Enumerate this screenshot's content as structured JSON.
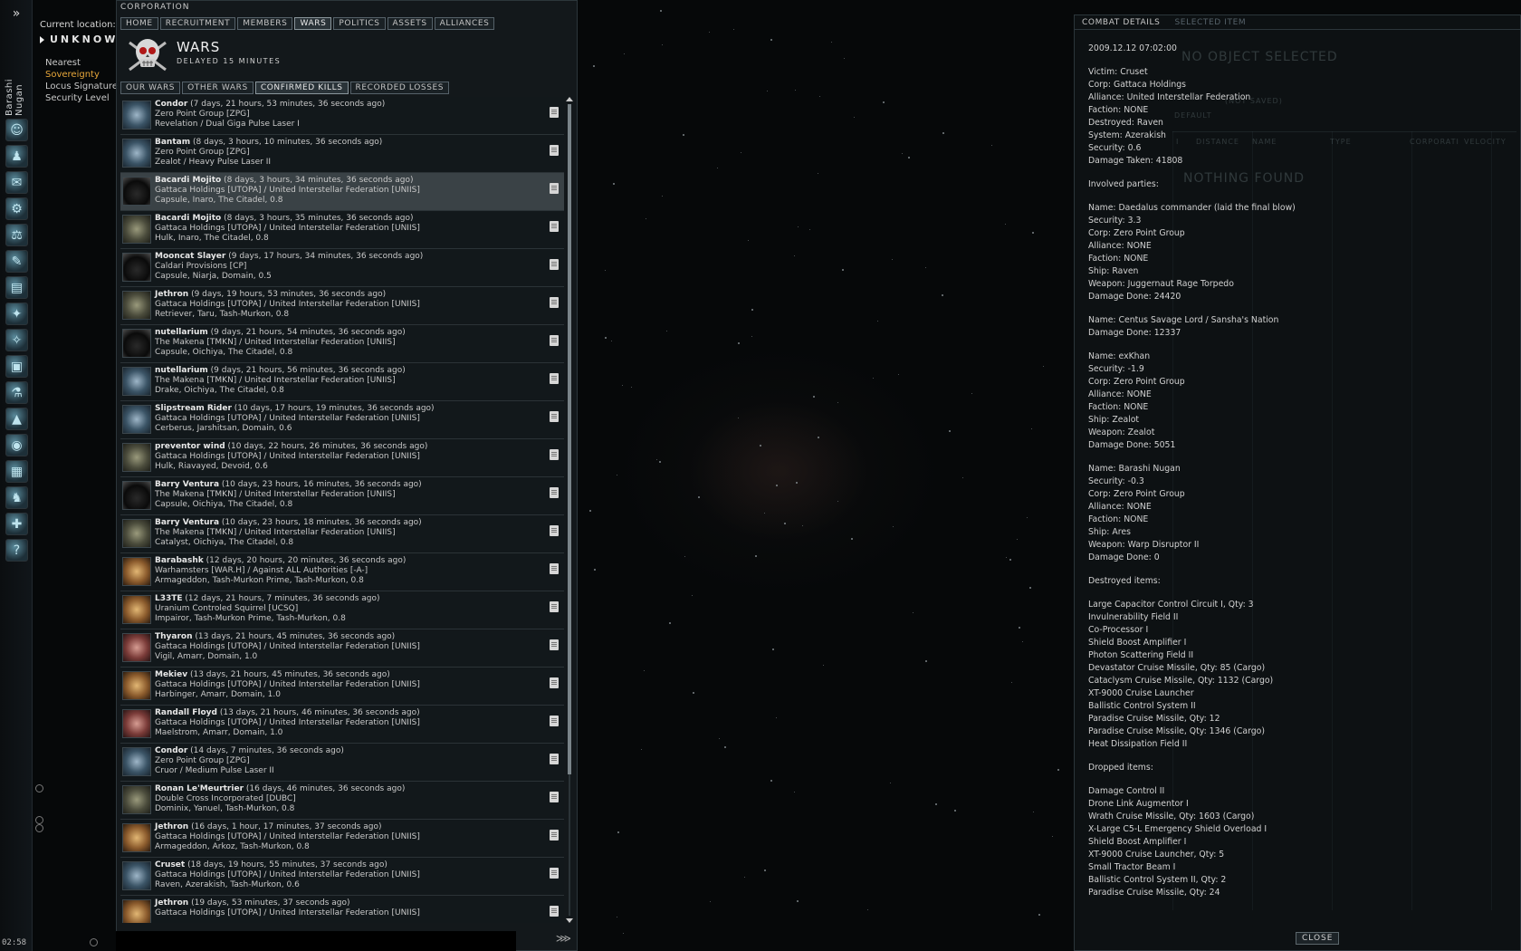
{
  "neocom": {
    "character_name": "Barashi Nugan",
    "clock": "02:58"
  },
  "location": {
    "label": "Current location:",
    "system": "UNKNOW",
    "links": [
      "Nearest",
      "Sovereignty",
      "Locus Signature",
      "Security Level"
    ]
  },
  "corp_window": {
    "title": "CORPORATION",
    "tabs": [
      "HOME",
      "RECRUITMENT",
      "MEMBERS",
      "WARS",
      "POLITICS",
      "ASSETS",
      "ALLIANCES"
    ],
    "active_tab": "WARS",
    "header_title": "WARS",
    "header_sub": "DELAYED 15 MINUTES",
    "subtabs": [
      "OUR WARS",
      "OTHER WARS",
      "CONFIRMED KILLS",
      "RECORDED LOSSES"
    ],
    "active_subtab": "CONFIRMED KILLS"
  },
  "kills": [
    {
      "name": "Condor",
      "time": "(7 days, 21 hours, 53 minutes, 36 seconds ago)",
      "l2": "Zero Point Group [ZPG]",
      "l3": "Revelation / Dual Giga Pulse Laser I",
      "t": "frig"
    },
    {
      "name": "Bantam",
      "time": "(8 days, 3 hours, 10 minutes, 36 seconds ago)",
      "l2": "Zero Point Group [ZPG]",
      "l3": "Zealot / Heavy Pulse Laser II",
      "t": "frig"
    },
    {
      "name": "Bacardi Mojito",
      "time": "(8 days, 3 hours, 34 minutes, 36 seconds ago)",
      "l2": "Gattaca Holdings [UTOPA] / United Interstellar Federation [UNIIS]",
      "l3": "Capsule, Inaro, The Citadel, 0.8",
      "t": "pod",
      "selected": true
    },
    {
      "name": "Bacardi Mojito",
      "time": "(8 days, 3 hours, 35 minutes, 36 seconds ago)",
      "l2": "Gattaca Holdings [UTOPA] / United Interstellar Federation [UNIIS]",
      "l3": "Hulk, Inaro, The Citadel, 0.8",
      "t": "ind"
    },
    {
      "name": "Mooncat Slayer",
      "time": "(9 days, 17 hours, 34 minutes, 36 seconds ago)",
      "l2": "Caldari Provisions [CP]",
      "l3": "Capsule, Niarja, Domain, 0.5",
      "t": "pod"
    },
    {
      "name": "Jethron",
      "time": "(9 days, 19 hours, 53 minutes, 36 seconds ago)",
      "l2": "Gattaca Holdings [UTOPA] / United Interstellar Federation [UNIIS]",
      "l3": "Retriever, Taru, Tash-Murkon, 0.8",
      "t": "ind"
    },
    {
      "name": "nutellarium",
      "time": "(9 days, 21 hours, 54 minutes, 36 seconds ago)",
      "l2": "The Makena [TMKN] / United Interstellar Federation [UNIIS]",
      "l3": "Capsule, Oichiya, The Citadel, 0.8",
      "t": "pod"
    },
    {
      "name": "nutellarium",
      "time": "(9 days, 21 hours, 56 minutes, 36 seconds ago)",
      "l2": "The Makena [TMKN] / United Interstellar Federation [UNIIS]",
      "l3": "Drake, Oichiya, The Citadel, 0.8",
      "t": "frig"
    },
    {
      "name": "Slipstream Rider",
      "time": "(10 days, 17 hours, 19 minutes, 36 seconds ago)",
      "l2": "Gattaca Holdings [UTOPA] / United Interstellar Federation [UNIIS]",
      "l3": "Cerberus, Jarshitsan, Domain, 0.6",
      "t": "frig"
    },
    {
      "name": "preventor wind",
      "time": "(10 days, 22 hours, 26 minutes, 36 seconds ago)",
      "l2": "Gattaca Holdings [UTOPA] / United Interstellar Federation [UNIIS]",
      "l3": "Hulk, Riavayed, Devoid, 0.6",
      "t": "ind"
    },
    {
      "name": "Barry Ventura",
      "time": "(10 days, 23 hours, 16 minutes, 36 seconds ago)",
      "l2": "The Makena [TMKN] / United Interstellar Federation [UNIIS]",
      "l3": "Capsule, Oichiya, The Citadel, 0.8",
      "t": "pod"
    },
    {
      "name": "Barry Ventura",
      "time": "(10 days, 23 hours, 18 minutes, 36 seconds ago)",
      "l2": "The Makena [TMKN] / United Interstellar Federation [UNIIS]",
      "l3": "Catalyst, Oichiya, The Citadel, 0.8",
      "t": "ind"
    },
    {
      "name": "Barabashk",
      "time": "(12 days, 20 hours, 20 minutes, 36 seconds ago)",
      "l2": "Warhamsters [WAR.H] / Against ALL Authorities [-A-]",
      "l3": "Armageddon, Tash-Murkon Prime, Tash-Murkon, 0.8",
      "t": "amarr"
    },
    {
      "name": "L33TE",
      "time": "(12 days, 21 hours, 7 minutes, 36 seconds ago)",
      "l2": "Uranium Controled Squirrel [UCSQ]",
      "l3": "Impairor, Tash-Murkon Prime, Tash-Murkon, 0.8",
      "t": "amarr"
    },
    {
      "name": "Thyaron",
      "time": "(13 days, 21 hours, 45 minutes, 36 seconds ago)",
      "l2": "Gattaca Holdings [UTOPA] / United Interstellar Federation [UNIIS]",
      "l3": "Vigil, Amarr, Domain, 1.0",
      "t": "red"
    },
    {
      "name": "Mekiev",
      "time": "(13 days, 21 hours, 45 minutes, 36 seconds ago)",
      "l2": "Gattaca Holdings [UTOPA] / United Interstellar Federation [UNIIS]",
      "l3": "Harbinger, Amarr, Domain, 1.0",
      "t": "amarr"
    },
    {
      "name": "Randall Floyd",
      "time": "(13 days, 21 hours, 46 minutes, 36 seconds ago)",
      "l2": "Gattaca Holdings [UTOPA] / United Interstellar Federation [UNIIS]",
      "l3": "Maelstrom, Amarr, Domain, 1.0",
      "t": "red"
    },
    {
      "name": "Condor",
      "time": "(14 days, 7 minutes, 36 seconds ago)",
      "l2": "Zero Point Group [ZPG]",
      "l3": "Cruor / Medium Pulse Laser II",
      "t": "frig"
    },
    {
      "name": "Ronan Le'Meurtrier",
      "time": "(16 days, 46 minutes, 36 seconds ago)",
      "l2": "Double Cross Incorporated [DUBC]",
      "l3": "Dominix, Yanuel, Tash-Murkon, 0.8",
      "t": "ind"
    },
    {
      "name": "Jethron",
      "time": "(16 days, 1 hour, 17 minutes, 37 seconds ago)",
      "l2": "Gattaca Holdings [UTOPA] / United Interstellar Federation [UNIIS]",
      "l3": "Armageddon, Arkoz, Tash-Murkon, 0.8",
      "t": "amarr"
    },
    {
      "name": "Cruset",
      "time": "(18 days, 19 hours, 55 minutes, 37 seconds ago)",
      "l2": "Gattaca Holdings [UTOPA] / United Interstellar Federation [UNIIS]",
      "l3": "Raven, Azerakish, Tash-Murkon, 0.6",
      "t": "frig"
    },
    {
      "name": "Jethron",
      "time": "(19 days, 53 minutes, 37 seconds ago)",
      "l2": "Gattaca Holdings [UTOPA] / United Interstellar Federation [UNIIS]",
      "l3": "",
      "t": "amarr"
    }
  ],
  "combat": {
    "tab_active": "COMBAT DETAILS",
    "tab_other": "SELECTED ITEM",
    "ghost_title": "NO OBJECT SELECTED",
    "ghost_found": "NOTHING FOUND",
    "ghost_default": "DEFAULT",
    "ghost_cols": [
      "I",
      "DISTANCE",
      "NAME",
      "TYPE",
      "CORPORATI",
      "VELOCITY"
    ],
    "ghost_notsaved": "(NOT SAVED)",
    "close": "CLOSE",
    "lines": [
      "2009.12.12 07:02:00",
      "",
      "Victim: Cruset",
      "Corp: Gattaca Holdings",
      "Alliance: United Interstellar Federation",
      "Faction: NONE",
      "Destroyed: Raven",
      "System: Azerakish",
      "Security: 0.6",
      "Damage Taken: 41808",
      "",
      "Involved parties:",
      "",
      "Name: Daedalus commander (laid the final blow)",
      "Security: 3.3",
      "Corp: Zero Point Group",
      "Alliance: NONE",
      "Faction: NONE",
      "Ship: Raven",
      "Weapon: Juggernaut Rage Torpedo",
      "Damage Done: 24420",
      "",
      "Name: Centus Savage Lord / Sansha's Nation",
      "Damage Done: 12337",
      "",
      "Name: exKhan",
      "Security: -1.9",
      "Corp: Zero Point Group",
      "Alliance: NONE",
      "Faction: NONE",
      "Ship: Zealot",
      "Weapon: Zealot",
      "Damage Done: 5051",
      "",
      "Name: Barashi Nugan",
      "Security: -0.3",
      "Corp: Zero Point Group",
      "Alliance: NONE",
      "Faction: NONE",
      "Ship: Ares",
      "Weapon: Warp Disruptor II",
      "Damage Done: 0",
      "",
      "Destroyed items:",
      "",
      "Large Capacitor Control Circuit I, Qty: 3",
      "Invulnerability Field II",
      "Co-Processor I",
      "Shield Boost Amplifier I",
      "Photon Scattering Field II",
      "Devastator Cruise Missile, Qty: 85 (Cargo)",
      "Cataclysm Cruise Missile, Qty: 1132 (Cargo)",
      "XT-9000 Cruise Launcher",
      "Ballistic Control System II",
      "Paradise Cruise Missile, Qty: 12",
      "Paradise Cruise Missile, Qty: 1346 (Cargo)",
      "Heat Dissipation Field II",
      "",
      "Dropped items:",
      "",
      "Damage Control II",
      "Drone Link Augmentor I",
      "Wrath Cruise Missile, Qty: 1603 (Cargo)",
      "X-Large C5-L Emergency Shield Overload I",
      "Shield Boost Amplifier I",
      "XT-9000 Cruise Launcher, Qty: 5",
      "Small Tractor Beam I",
      "Ballistic Control System II, Qty: 2",
      "Paradise Cruise Missile, Qty: 24"
    ]
  }
}
